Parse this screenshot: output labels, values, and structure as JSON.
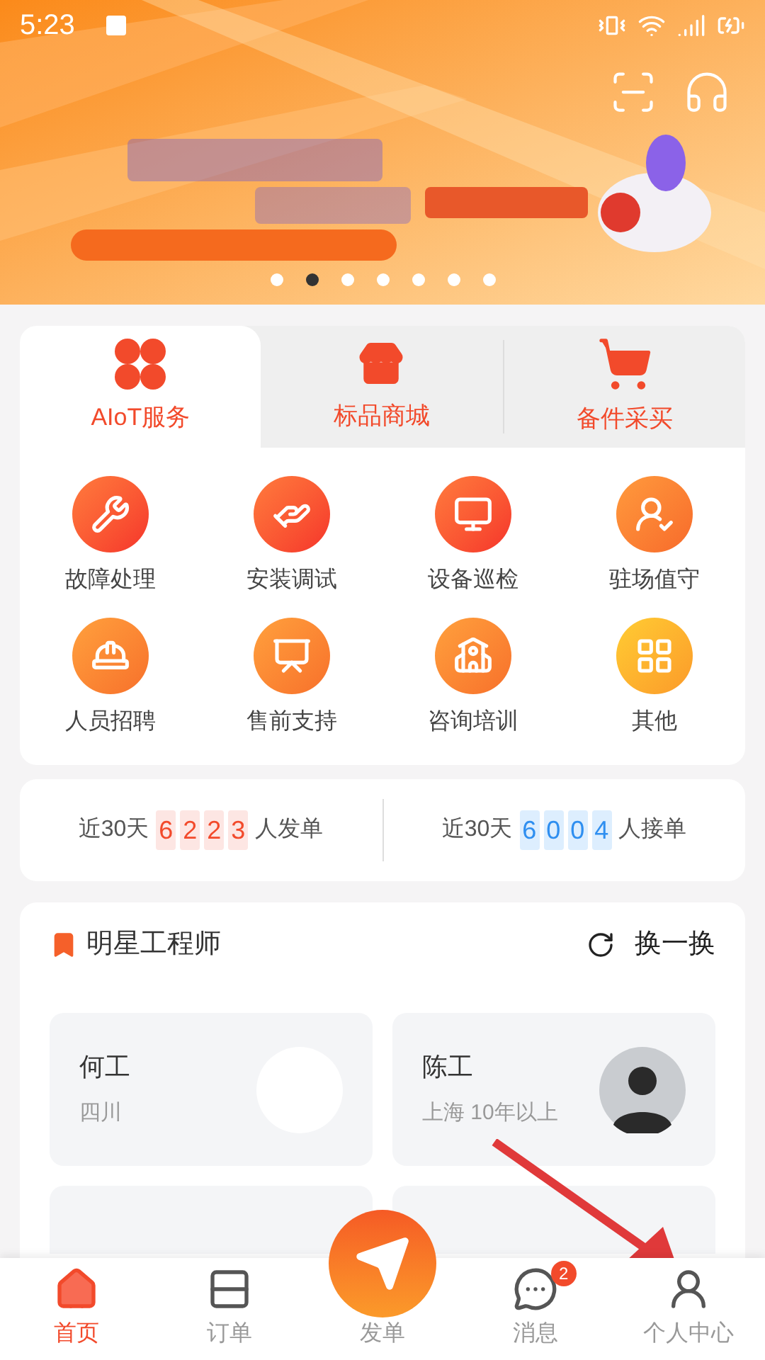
{
  "status_bar": {
    "time": "5:23"
  },
  "banner": {
    "kind": "picture",
    "dots": [
      {
        "selected": false
      },
      {
        "selected": true
      },
      {
        "selected": false
      },
      {
        "selected": false
      },
      {
        "selected": false
      },
      {
        "selected": false
      },
      {
        "selected": false
      }
    ]
  },
  "tabs": [
    {
      "label": "AIoT服务",
      "selected": true
    },
    {
      "label": "标品商城",
      "selected": false
    },
    {
      "label": "备件采买",
      "selected": false
    }
  ],
  "services": [
    {
      "label": "故障处理"
    },
    {
      "label": "安装调试"
    },
    {
      "label": "设备巡检"
    },
    {
      "label": "驻场值守"
    },
    {
      "label": "人员招聘"
    },
    {
      "label": "售前支持"
    },
    {
      "label": "咨询培训"
    },
    {
      "label": "其他"
    }
  ],
  "stats": [
    {
      "kind": "send",
      "prefix": "近30天",
      "digits": [
        "6",
        "2",
        "2",
        "3"
      ],
      "suffix": "人发单"
    },
    {
      "kind": "receive",
      "prefix": "近30天",
      "digits": [
        "6",
        "0",
        "0",
        "4"
      ],
      "suffix": "人接单"
    }
  ],
  "engineers": {
    "title": "明星工程师",
    "refresh": "换一换",
    "cards": [
      {
        "name": "何工",
        "info": "四川"
      },
      {
        "name": "陈工",
        "info": "上海 10年以上"
      }
    ]
  },
  "nav": [
    {
      "kind": "home",
      "label": "首页",
      "selected": true
    },
    {
      "kind": "orders",
      "label": "订单",
      "selected": false
    },
    {
      "kind": "publish",
      "label": "发单",
      "selected": false
    },
    {
      "kind": "messages",
      "label": "消息",
      "selected": false,
      "badge": "2"
    },
    {
      "kind": "profile",
      "label": "个人中心",
      "selected": false
    }
  ]
}
